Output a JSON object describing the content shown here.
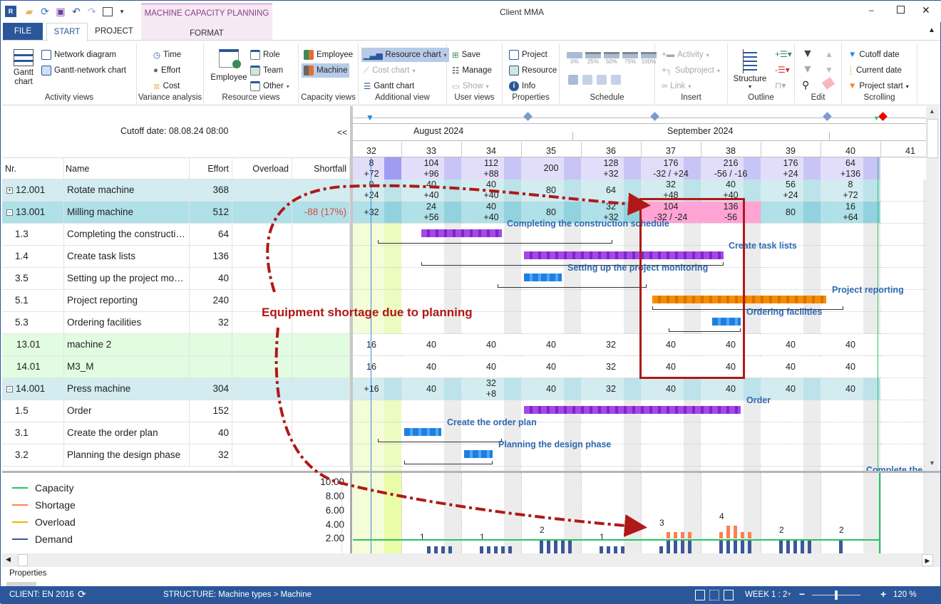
{
  "window": {
    "title": "Client MMA",
    "context_tab": "MACHINE CAPACITY PLANNING"
  },
  "tabs": [
    {
      "label": "FILE"
    },
    {
      "label": "START"
    },
    {
      "label": "PROJECT"
    },
    {
      "label": "FORMAT"
    }
  ],
  "ribbon": {
    "activity_views": {
      "label": "Activity views",
      "gantt": "Gantt chart",
      "network": "Network diagram",
      "gantt_network": "Gantt-network chart"
    },
    "variance": {
      "label": "Variance analysis",
      "time": "Time",
      "effort": "Effort",
      "cost": "Cost"
    },
    "resource_views": {
      "label": "Resource views",
      "employee": "Employee",
      "role": "Role",
      "team": "Team",
      "other": "Other"
    },
    "capacity_views": {
      "label": "Capacity views",
      "employee": "Employee",
      "machine": "Machine"
    },
    "additional": {
      "label": "Additional view",
      "resource_chart": "Resource chart",
      "cost_chart": "Cost chart",
      "gantt_chart": "Gantt chart"
    },
    "user_views": {
      "label": "User views",
      "save": "Save",
      "manage": "Manage",
      "show": "Show"
    },
    "properties": {
      "label": "Properties",
      "project": "Project",
      "resource": "Resource",
      "info": "Info"
    },
    "schedule": {
      "label": "Schedule",
      "pcts": [
        "0%",
        "25%",
        "50%",
        "75%",
        "100%"
      ]
    },
    "insert": {
      "label": "Insert",
      "activity": "Activity",
      "subproject": "Subproject",
      "link": "Link"
    },
    "outline": {
      "label": "Outline",
      "structure": "Structure"
    },
    "edit": {
      "label": "Edit"
    },
    "scrolling": {
      "label": "Scrolling",
      "cutoff": "Cutoff date",
      "current": "Current date",
      "project_start": "Project start"
    }
  },
  "grid": {
    "cutoff_label": "Cutoff date: 08.08.24 08:00",
    "collapse": "<<",
    "columns": [
      "Nr.",
      "Name",
      "Effort",
      "Overload",
      "Shortfall"
    ],
    "rows": [
      {
        "nr": "12.001",
        "name": "Rotate machine",
        "effort": "368",
        "shortfall": "",
        "type": "group",
        "expander": "+"
      },
      {
        "nr": "13.001",
        "name": "Milling machine",
        "effort": "512",
        "shortfall": "-88 (17%)",
        "type": "group2",
        "expander": "-"
      },
      {
        "nr": "1.3",
        "name": "Completing the construction schedule",
        "effort": "64",
        "type": "task"
      },
      {
        "nr": "1.4",
        "name": "Create task lists",
        "effort": "136",
        "type": "task"
      },
      {
        "nr": "3.5",
        "name": "Setting up the project monitoring",
        "effort": "40",
        "type": "task"
      },
      {
        "nr": "5.1",
        "name": "Project reporting",
        "effort": "240",
        "type": "task"
      },
      {
        "nr": "5.3",
        "name": "Ordering facilities",
        "effort": "32",
        "type": "task"
      },
      {
        "nr": "13.01",
        "name": "machine 2",
        "effort": "",
        "type": "machine"
      },
      {
        "nr": "14.01",
        "name": "M3_M",
        "effort": "",
        "type": "machine"
      },
      {
        "nr": "14.001",
        "name": "Press machine",
        "effort": "304",
        "type": "group",
        "expander": "-"
      },
      {
        "nr": "1.5",
        "name": "Order",
        "effort": "152",
        "type": "task"
      },
      {
        "nr": "3.1",
        "name": "Create the order plan",
        "effort": "40",
        "type": "task"
      },
      {
        "nr": "3.2",
        "name": "Planning the design phase",
        "effort": "32",
        "type": "task"
      }
    ]
  },
  "timeline": {
    "months": [
      "August 2024",
      "September 2024"
    ],
    "weeks": [
      "32",
      "33",
      "34",
      "35",
      "36",
      "37",
      "38",
      "39",
      "40",
      "41"
    ],
    "summary": [
      [
        "8",
        "+72"
      ],
      [
        "104",
        "+96"
      ],
      [
        "112",
        "+88"
      ],
      [
        "200"
      ],
      [
        "128",
        "+32"
      ],
      [
        "176",
        "-32 / +24"
      ],
      [
        "216",
        "-56 / -16"
      ],
      [
        "176",
        "+24"
      ],
      [
        "64",
        "+136"
      ]
    ],
    "rows": {
      "0": [
        [
          "0",
          "+24"
        ],
        [
          "40",
          "+40"
        ],
        [
          "40",
          "+40"
        ],
        [
          "80"
        ],
        [
          "64"
        ],
        [
          "32",
          "+48"
        ],
        [
          "40",
          "+40"
        ],
        [
          "56",
          "+24"
        ],
        [
          "8",
          "+72"
        ]
      ],
      "1": [
        [
          "",
          "+32"
        ],
        [
          "24",
          "+56"
        ],
        [
          "40",
          "+40"
        ],
        [
          "80"
        ],
        [
          "32",
          "+32"
        ],
        [
          "104",
          "-32 / -24"
        ],
        [
          "136",
          "-56"
        ],
        [
          "80"
        ],
        [
          "16",
          "+64"
        ]
      ],
      "7": [
        [
          "16"
        ],
        [
          "40"
        ],
        [
          "40"
        ],
        [
          "40"
        ],
        [
          "32"
        ],
        [
          "40"
        ],
        [
          "40"
        ],
        [
          "40"
        ],
        [
          "40"
        ]
      ],
      "8": [
        [
          "16"
        ],
        [
          "40"
        ],
        [
          "40"
        ],
        [
          "40"
        ],
        [
          "32"
        ],
        [
          "40"
        ],
        [
          "40"
        ],
        [
          "40"
        ],
        [
          "40"
        ]
      ],
      "9": [
        [
          "",
          "+16"
        ],
        [
          "40"
        ],
        [
          "32",
          "+8"
        ],
        [
          "40"
        ],
        [
          "32"
        ],
        [
          "40"
        ],
        [
          "40"
        ],
        [
          "40"
        ],
        [
          "40"
        ]
      ]
    },
    "shortage_cells": [
      [
        1,
        5
      ],
      [
        1,
        6
      ]
    ],
    "task_labels": {
      "r2": "Completing the construction schedule",
      "r3": "Create task lists",
      "r4": "Setting up the project monitoring",
      "r5": "Project reporting",
      "r6": "Ordering facilities",
      "r10": "Order",
      "r11": "Create the order plan",
      "r12": "Planning the design phase",
      "r13": "Complete the..."
    }
  },
  "annotation": {
    "text": "Equipment shortage due to planning",
    "color": "#b01818"
  },
  "capacity_chart": {
    "type": "bar",
    "legend": [
      {
        "name": "Capacity",
        "color": "#22c55e"
      },
      {
        "name": "Shortage",
        "color": "#ff7f50"
      },
      {
        "name": "Overload",
        "color": "#f0b400"
      },
      {
        "name": "Demand",
        "color": "#3b5998"
      }
    ],
    "yticks": [
      "10.00",
      "8.00",
      "6.00",
      "4.00",
      "2.00"
    ],
    "capacity": 2,
    "weeks": [
      "33",
      "34",
      "35",
      "36",
      "37",
      "38",
      "39",
      "40"
    ],
    "daily_values": [
      [
        0,
        1,
        1,
        1,
        1
      ],
      [
        1,
        1,
        1,
        1,
        1
      ],
      [
        2,
        2,
        2,
        2,
        2
      ],
      [
        1,
        1,
        1,
        1,
        0
      ],
      [
        1,
        3,
        3,
        3,
        3
      ],
      [
        3,
        4,
        4,
        3,
        3
      ],
      [
        2,
        2,
        2,
        2,
        2
      ],
      [
        2,
        0,
        0,
        0,
        0
      ]
    ],
    "week_labels": [
      "1",
      "1",
      "2",
      "1",
      "3",
      "4",
      "2",
      "2"
    ]
  },
  "properties_tab": "Properties",
  "status": {
    "client": "CLIENT: EN 2016",
    "structure": "STRUCTURE: Machine types > Machine",
    "scale": "WEEK 1 : 2",
    "zoom": "120 %",
    "minus": "−",
    "plus": "+"
  }
}
